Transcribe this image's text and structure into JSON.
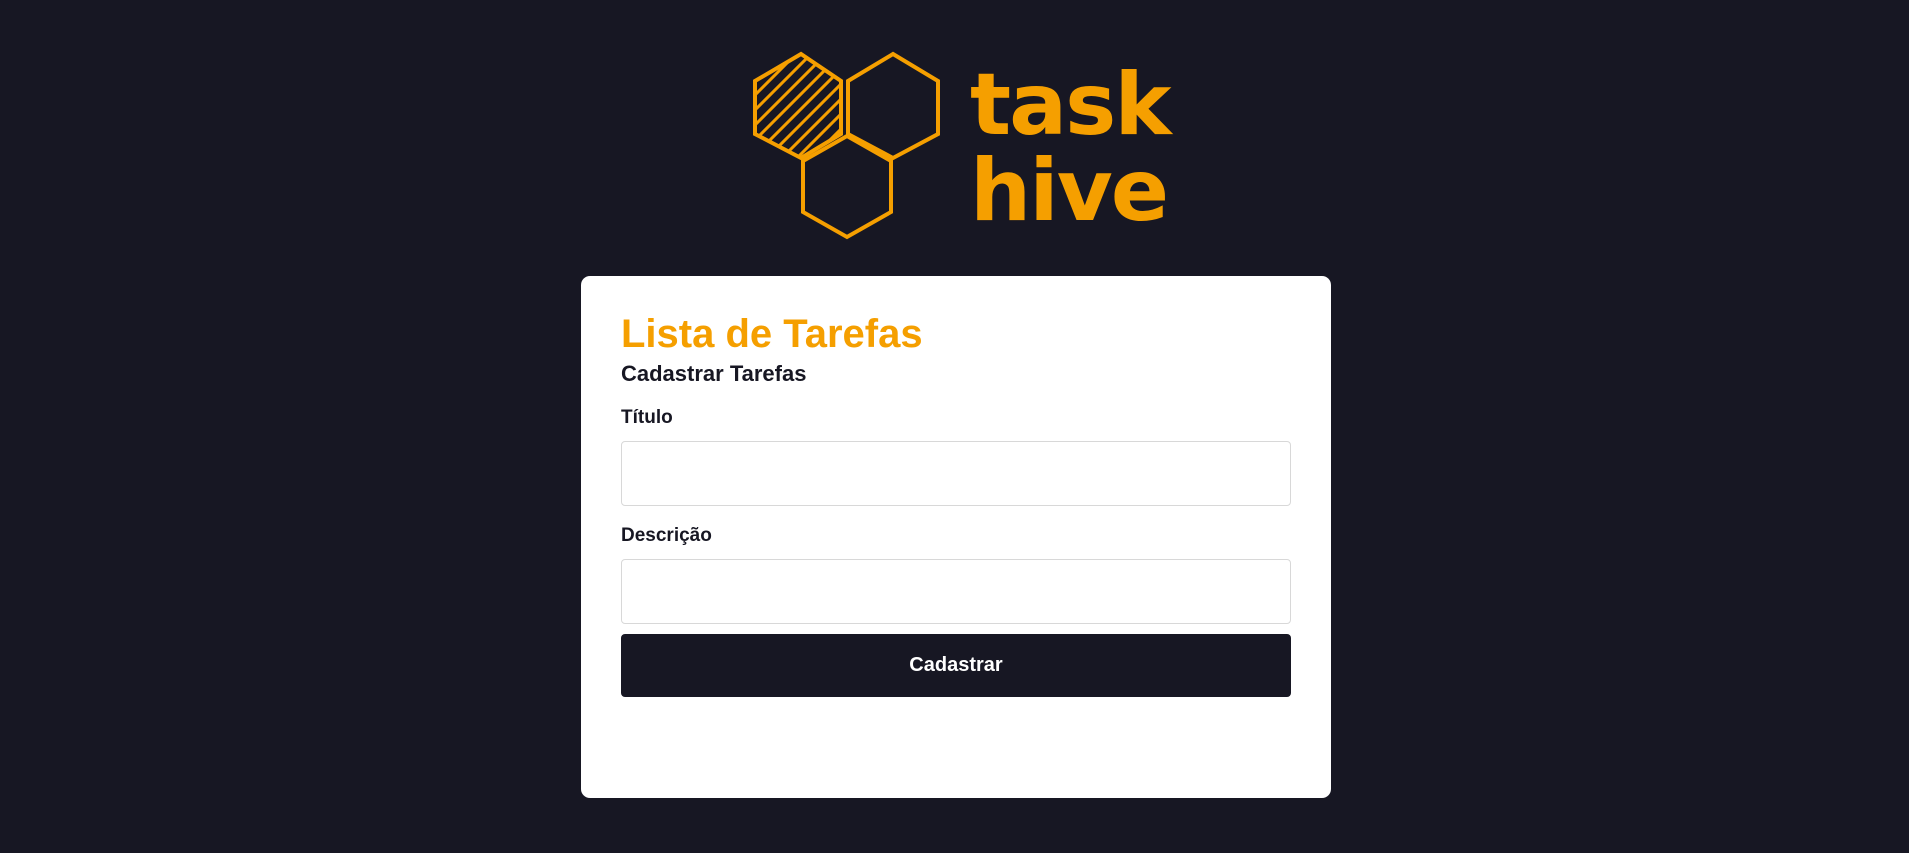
{
  "brand": {
    "line1": "task",
    "line2": "hive",
    "accent_color": "#f59f00",
    "icon": "honeycomb-logo-icon"
  },
  "colors": {
    "background": "#171723",
    "card": "#ffffff",
    "button": "#171723",
    "button_text": "#ffffff"
  },
  "card": {
    "title": "Lista de Tarefas",
    "subtitle": "Cadastrar Tarefas",
    "fields": [
      {
        "label": "Título",
        "value": "",
        "placeholder": ""
      },
      {
        "label": "Descrição",
        "value": "",
        "placeholder": ""
      }
    ],
    "submit_label": "Cadastrar"
  }
}
